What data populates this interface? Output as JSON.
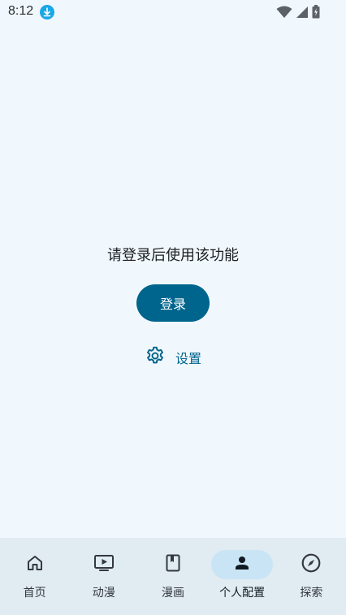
{
  "status_bar": {
    "time": "8:12",
    "icons": [
      "download-icon",
      "wifi-icon",
      "signal-icon",
      "battery-charging-icon"
    ]
  },
  "main": {
    "prompt_text": "请登录后使用该功能",
    "login_label": "登录",
    "settings_label": "设置"
  },
  "bottom_nav": {
    "items": [
      {
        "label": "首页",
        "icon": "home-icon"
      },
      {
        "label": "动漫",
        "icon": "play-screen-icon"
      },
      {
        "label": "漫画",
        "icon": "book-icon"
      },
      {
        "label": "个人配置",
        "icon": "person-icon",
        "active": true
      },
      {
        "label": "探索",
        "icon": "compass-icon"
      }
    ]
  },
  "colors": {
    "background": "#f1f8fd",
    "primary": "#00658d",
    "nav_background": "#e1ebf2",
    "active_pill": "#c9e5f5"
  }
}
